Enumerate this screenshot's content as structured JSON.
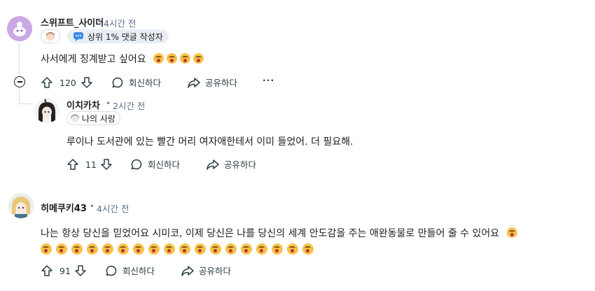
{
  "comments": [
    {
      "username": "스위프트_사이더",
      "time": "4시간 전",
      "badge": "상위 1% 댓글 작성자",
      "body": "사서에게 징계받고 싶어요",
      "emoji_count": 4,
      "votes": "120",
      "reply_label": "회신하다",
      "share_label": "공유하다",
      "more_label": "···"
    },
    {
      "username": "이치카차",
      "time": "2시간 전",
      "flair": "나의 사랑",
      "body": "루이나 도서관에 있는 빨간 머리 여자애한테서 이미 들었어. 더 필요해.",
      "votes": "11",
      "reply_label": "회신하다",
      "share_label": "공유하다"
    },
    {
      "username": "히메쿠키43",
      "time": "4시간 전",
      "body": "나는 항상 당신을 믿었어요 시미코, 이제 당신은 나를 당신의 세계 안도감을 주는 애완동물로 만들어 줄 수 있어요",
      "emoji_count_line2": 18,
      "votes": "91",
      "reply_label": "회신하다",
      "share_label": "공유하다"
    }
  ],
  "dot": "•",
  "colors": {
    "text": "#1c1c1c",
    "meta": "#5b6e86",
    "thread": "#d9dee3",
    "badge_bg": "#e9eef5"
  }
}
